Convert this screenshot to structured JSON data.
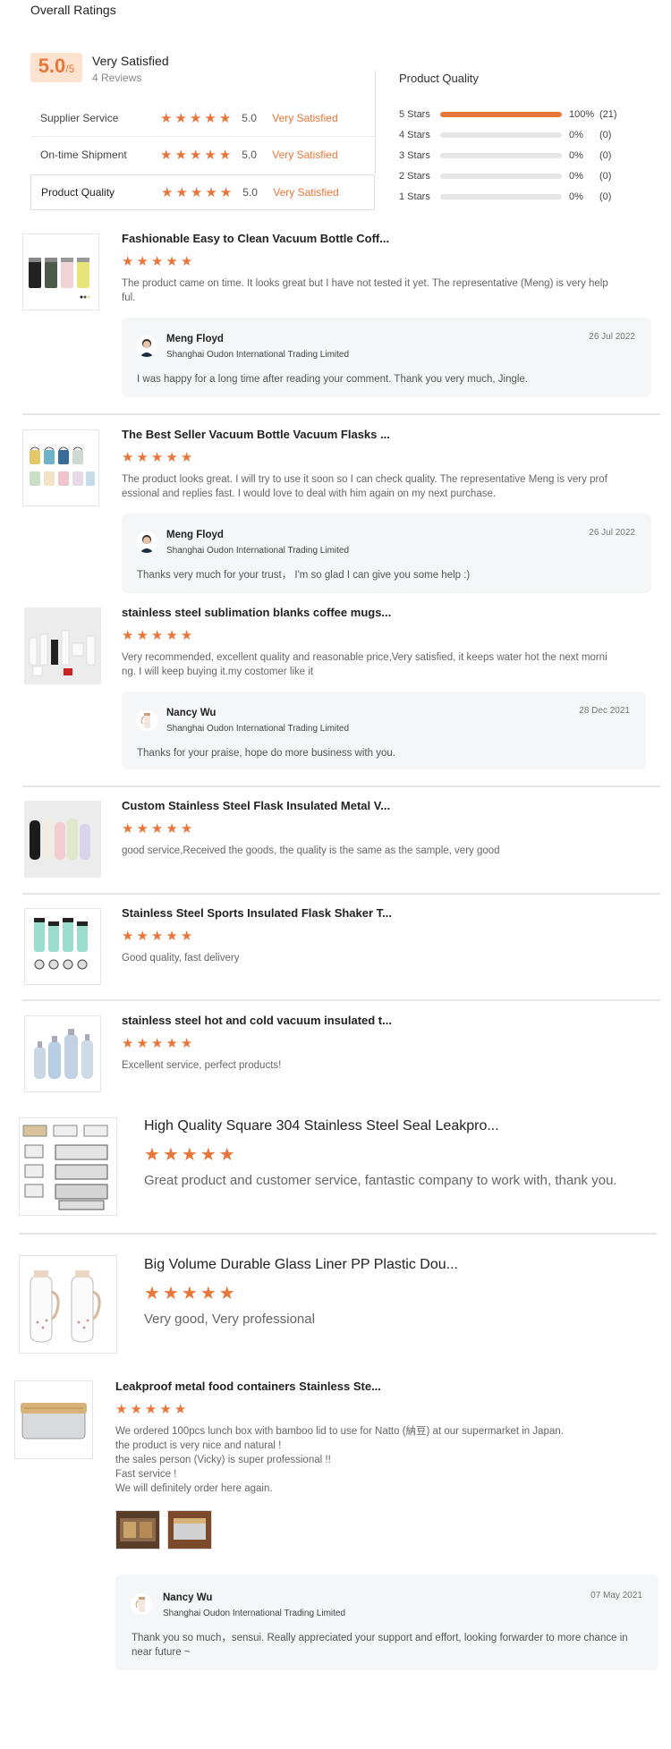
{
  "header": {
    "title": "Overall Ratings"
  },
  "summary": {
    "score": "5.0",
    "out_of": "/5",
    "label": "Very Satisfied",
    "reviews": "4 Reviews"
  },
  "ratings": [
    {
      "label": "Supplier Service",
      "value": "5.0",
      "text": "Very Satisfied",
      "stars": 5
    },
    {
      "label": "On-time Shipment",
      "value": "5.0",
      "text": "Very Satisfied",
      "stars": 5
    },
    {
      "label": "Product Quality",
      "value": "5.0",
      "text": "Very Satisfied",
      "stars": 5
    }
  ],
  "product_quality": {
    "title": "Product Quality",
    "rows": [
      {
        "label": "5 Stars",
        "fraction": 1.0,
        "pct": "100%",
        "count": "(21)"
      },
      {
        "label": "4 Stars",
        "fraction": 0,
        "pct": "0%",
        "count": "(0)"
      },
      {
        "label": "3 Stars",
        "fraction": 0,
        "pct": "0%",
        "count": "(0)"
      },
      {
        "label": "2 Stars",
        "fraction": 0,
        "pct": "0%",
        "count": "(0)"
      },
      {
        "label": "1 Stars",
        "fraction": 0,
        "pct": "0%",
        "count": "(0)"
      }
    ]
  },
  "colors": {
    "accent": "#e8763a",
    "score_bg": "#fde3cf",
    "reply_bg": "#f5f6f8"
  },
  "reviews": [
    {
      "title": "Fashionable Easy to Clean Vacuum Bottle Coff...",
      "stars": 5,
      "comment": "The product came on time. It looks great but I have not tested it yet. The representative (Meng) is very help ful.",
      "reply": {
        "name": "Meng Floyd",
        "company": "Shanghai Oudon International Trading Limited",
        "date": "26 Jul 2022",
        "text": "I was happy for a long time after reading your comment. Thank you very much, Jingle."
      }
    },
    {
      "title": "The Best Seller Vacuum Bottle Vacuum Flasks ...",
      "stars": 5,
      "comment": "The product looks great. I will try to use it soon so I can check quality. The representative Meng is very prof essional and replies fast. I would love to deal with him again on my next purchase.",
      "reply": {
        "name": "Meng Floyd",
        "company": "Shanghai Oudon International Trading Limited",
        "date": "26 Jul 2022",
        "text": "Thanks very much for your trust，  I'm so glad I can give you some help :)"
      }
    },
    {
      "title": "stainless steel sublimation blanks coffee mugs...",
      "stars": 5,
      "comment": "Very recommended, excellent quality and reasonable price,Very satisfied, it keeps water hot the next morni ng. I will keep buying it.my costomer like it",
      "reply": {
        "name": "Nancy Wu",
        "company": "Shanghai Oudon International Trading Limited",
        "date": "28 Dec 2021",
        "text": "Thanks for your praise, hope do more business with you."
      }
    },
    {
      "title": "Custom Stainless Steel Flask Insulated Metal V...",
      "stars": 5,
      "comment": "good service,Received the goods, the quality is the same as the sample, very good"
    },
    {
      "title": "Stainless Steel Sports Insulated Flask Shaker T...",
      "stars": 5,
      "comment": "Good quality, fast delivery"
    },
    {
      "title": "stainless steel hot and cold vacuum insulated t...",
      "stars": 5,
      "comment": "Excellent service, perfect products!"
    },
    {
      "title": "High Quality Square 304 Stainless Steel Seal Leakpro...",
      "stars": 5,
      "comment": "Great product and customer service, fantastic company to work with, thank you."
    },
    {
      "title": "Big Volume Durable Glass Liner PP Plastic Dou...",
      "stars": 5,
      "comment": "Very good, Very professional"
    },
    {
      "title": "Leakproof metal food containers Stainless Ste...",
      "stars": 5,
      "comment_lines": [
        "We ordered 100pcs lunch box with bamboo lid to use for Natto (納豆) at our supermarket in Japan.",
        "the product is very nice and natural !",
        "the sales person (Vicky) is super professional !!",
        "Fast service !",
        "We will definitely order here again."
      ],
      "reply": {
        "name": "Nancy Wu",
        "company": "Shanghai Oudon International Trading Limited",
        "date": "07 May 2021",
        "text": "Thank you so much，sensui. Really appreciated your support and effort, looking forwarder to more chance in near future ~"
      }
    }
  ]
}
